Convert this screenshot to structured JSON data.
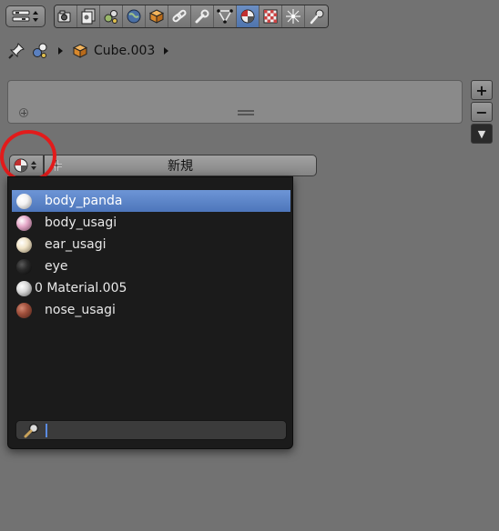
{
  "header": {
    "editor_type_icon": "properties-editor-icon",
    "context_tabs": [
      {
        "id": "render",
        "icon": "camera-icon",
        "active": false
      },
      {
        "id": "layers",
        "icon": "render-layers-icon",
        "active": false
      },
      {
        "id": "scene",
        "icon": "scene-icon",
        "active": false
      },
      {
        "id": "world",
        "icon": "world-icon",
        "active": false
      },
      {
        "id": "object",
        "icon": "object-cube-icon",
        "active": false
      },
      {
        "id": "constraints",
        "icon": "constraint-link-icon",
        "active": false
      },
      {
        "id": "modifiers",
        "icon": "wrench-icon",
        "active": false
      },
      {
        "id": "data",
        "icon": "mesh-data-icon",
        "active": false
      },
      {
        "id": "material",
        "icon": "material-sphere-icon",
        "active": true
      },
      {
        "id": "texture",
        "icon": "checker-texture-icon",
        "active": false
      },
      {
        "id": "particles",
        "icon": "particles-icon",
        "active": false
      },
      {
        "id": "physics",
        "icon": "physics-icon",
        "active": false
      }
    ]
  },
  "breadcrumb": {
    "object_name": "Cube.003"
  },
  "slot_panel": {
    "add_label": "+",
    "remove_label": "−",
    "specials_label": "▼"
  },
  "material_selector": {
    "new_label": "新規"
  },
  "dropdown": {
    "items": [
      {
        "label": "body_panda",
        "selected": true,
        "color": "#f2f2f2"
      },
      {
        "label": "body_usagi",
        "selected": false,
        "color": "#e6a9c9"
      },
      {
        "label": "ear_usagi",
        "selected": false,
        "color": "#f0e3c6"
      },
      {
        "label": "eye",
        "selected": false,
        "color": "#2a2a2a"
      },
      {
        "label": "0 Material.005",
        "selected": false,
        "color": "#d8d8d8"
      },
      {
        "label": "nose_usagi",
        "selected": false,
        "color": "#a0503c"
      }
    ],
    "search_value": ""
  },
  "colors": {
    "selection": "#5a84c8",
    "annotation": "#e21b1b"
  }
}
